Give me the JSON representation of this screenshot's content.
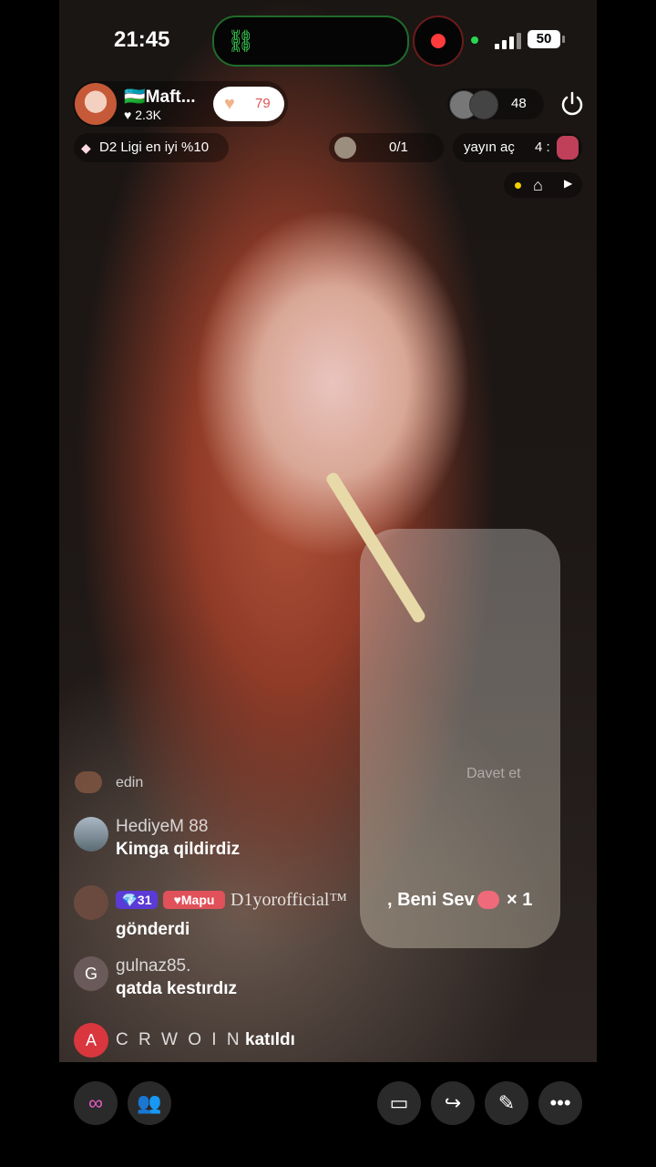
{
  "status": {
    "time": "21:45",
    "battery": "50"
  },
  "host": {
    "name": "Maft...",
    "likes": "2.3K",
    "follow_count": "79"
  },
  "viewers": {
    "count": "48"
  },
  "league": {
    "text": "D2 Ligi en iyi %10"
  },
  "goal": {
    "text": "0/1"
  },
  "rank": {
    "text": "yayın aç",
    "num": "4 :"
  },
  "faded_row": {
    "text": "edin",
    "side": "Davet et"
  },
  "comments": [
    {
      "user": "HediyeM 88",
      "message": "Kimga qildirdiz"
    },
    {
      "badge_level": "31",
      "badge_name": "Mapu",
      "user": "D1yorofficial™",
      "text": ", Beni Sev",
      "count": "× 1",
      "sent": "gönderdi"
    },
    {
      "avatar_letter": "G",
      "user": "gulnaz85.",
      "message": "qatda kestırdız"
    },
    {
      "avatar_letter": "A",
      "user": "C R W O I N",
      "message": "katıldı"
    }
  ],
  "icons": [
    "record-icon",
    "power-icon",
    "home-icon",
    "share-icon",
    "magic-wand-icon",
    "more-icon",
    "multi-guest-icon",
    "users-icon",
    "comment-icon"
  ],
  "colors": {
    "accent_red": "#ff3b3b",
    "follow_text": "#e05555",
    "badge_purple": "#5b3bd6",
    "badge_red": "#e0515a"
  }
}
